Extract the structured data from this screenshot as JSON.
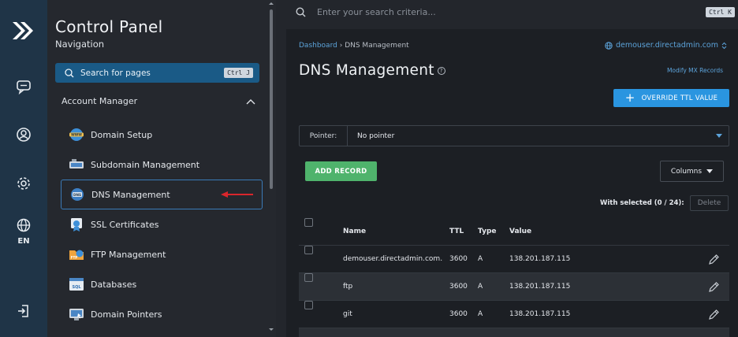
{
  "rail": {
    "language": "EN"
  },
  "nav": {
    "title": "Control Panel",
    "subtitle": "Navigation",
    "search_label": "Search for pages",
    "search_shortcut": "Ctrl J",
    "section": "Account Manager",
    "items": [
      {
        "label": "Domain Setup",
        "icon": "www-icon"
      },
      {
        "label": "Subdomain Management",
        "icon": "subdomain-icon"
      },
      {
        "label": "DNS Management",
        "icon": "dns-icon",
        "active": true
      },
      {
        "label": "SSL Certificates",
        "icon": "ssl-certificate-icon"
      },
      {
        "label": "FTP Management",
        "icon": "ftp-folder-icon"
      },
      {
        "label": "Databases",
        "icon": "database-icon"
      },
      {
        "label": "Domain Pointers",
        "icon": "domain-pointer-icon"
      }
    ]
  },
  "topbar": {
    "placeholder": "Enter your search criteria...",
    "shortcut": "Ctrl K"
  },
  "main": {
    "breadcrumb": {
      "root": "Dashboard",
      "separator": "›",
      "current": "DNS Management"
    },
    "domain": "demouser.directadmin.com",
    "title": "DNS Management",
    "modify_mx": "Modify MX Records",
    "override_ttl": "OVERRIDE TTL VALUE",
    "pointer_label": "Pointer:",
    "pointer_value": "No pointer",
    "add_record": "ADD RECORD",
    "columns": "Columns",
    "with_selected": "With selected (0 / 24):",
    "delete": "Delete",
    "table": {
      "headers": {
        "name": "Name",
        "ttl": "TTL",
        "type": "Type",
        "value": "Value"
      },
      "rows": [
        {
          "name": "demouser.directadmin.com.",
          "ttl": "3600",
          "type": "A",
          "value": "138.201.187.115"
        },
        {
          "name": "ftp",
          "ttl": "3600",
          "type": "A",
          "value": "138.201.187.115"
        },
        {
          "name": "git",
          "ttl": "3600",
          "type": "A",
          "value": "138.201.187.115"
        }
      ]
    }
  },
  "colors": {
    "rail": "#1f3447",
    "accent": "#2a95e0",
    "success": "#4fb36c",
    "link": "#5ca3da",
    "annotation_arrow": "#d9262c"
  }
}
